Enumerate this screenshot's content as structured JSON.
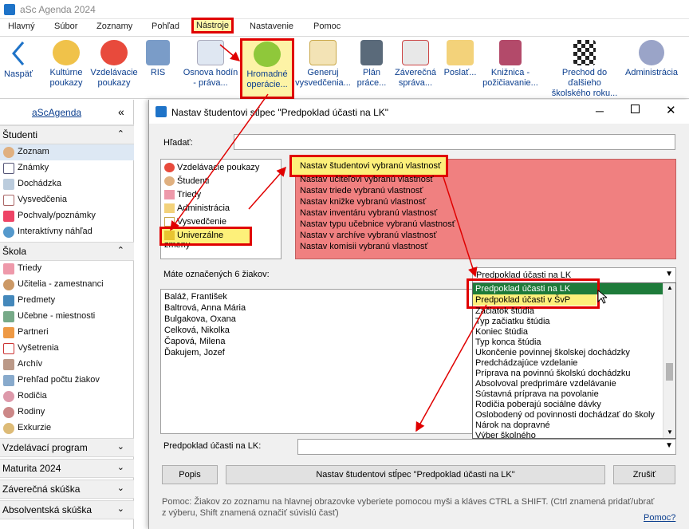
{
  "window": {
    "title": "aSc Agenda 2024"
  },
  "menubar": [
    "Hlavný",
    "Súbor",
    "Zoznamy",
    "Pohľad",
    "Nástroje",
    "Nastavenie",
    "Pomoc"
  ],
  "ribbon": [
    {
      "label": "Naspäť"
    },
    {
      "label": "Kultúrne poukazy"
    },
    {
      "label": "Vzdelávacie poukazy"
    },
    {
      "label": "RIS"
    },
    {
      "label": "Osnova hodín - práva..."
    },
    {
      "label": "Hromadné operácie..."
    },
    {
      "label": "Generuj vysvedčenia..."
    },
    {
      "label": "Plán práce..."
    },
    {
      "label": "Záverečná správa..."
    },
    {
      "label": "Poslať..."
    },
    {
      "label": "Knižnica - požičiavanie..."
    },
    {
      "label": "Prechod do ďalšieho školského roku..."
    },
    {
      "label": "Administrácia"
    }
  ],
  "sidebar": {
    "brand": "aScAgenda",
    "sec_studenti": "Študenti",
    "studenti_items": [
      "Zoznam",
      "Známky",
      "Dochádzka",
      "Vysvedčenia",
      "Pochvaly/poznámky",
      "Interaktívny náhľad"
    ],
    "sec_skola": "Škola",
    "skola_items": [
      "Triedy",
      "Učitelia - zamestnanci",
      "Predmety",
      "Učebne - miestnosti",
      "Partneri",
      "Vyšetrenia",
      "Archív",
      "Prehľad počtu žiakov",
      "Rodičia",
      "Rodiny",
      "Exkurzie"
    ],
    "collapsed": [
      "Vzdelávací program",
      "Maturita 2024",
      "Záverečná skúška",
      "Absolventská skúška"
    ]
  },
  "dialog": {
    "title": "Nastav študentovi stĺpec \"Predpoklad účasti na LK\"",
    "search_label": "Hľadať:",
    "categories": [
      "Vzdelávacie poukazy",
      "Študenti",
      "Triedy",
      "Administrácia",
      "Vysvedčenie",
      "Univerzálne zmeny"
    ],
    "actions": [
      "Nastav študentovi vybranú vlastnosť",
      "Nastav učiteľovi vybranú vlastnosť",
      "Nastav triede vybranú vlastnosť",
      "Nastav knižke vybranú vlastnosť",
      "Nastav inventáru vybranú vlastnosť",
      "Nastav typu učebnice vybranú vlastnosť",
      "Nastav v archíve vybranú vlastnosť",
      "Nastav komisii vybranú vlastnosť"
    ],
    "marked_label": "Máte označených 6 žiakov:",
    "students": [
      "Baláž, František",
      "Baltrová, Anna Mária",
      "Bulgakova, Oxana",
      "Celková, Nikolka",
      "Čapová, Milena",
      "Ďakujem, Jozef"
    ],
    "combo_value": "Predpoklad účasti na LK",
    "dropdown": [
      "Predpoklad účasti na LK",
      "Predpoklad účasti v ŠvP",
      "Začiatok štúdia",
      "Typ začiatku štúdia",
      "Koniec štúdia",
      "Typ konca štúdia",
      "Ukončenie povinnej školskej dochádzky",
      "Predchádzajúce vzdelanie",
      "Príprava na povinnú školskú dochádzku",
      "Absolvoval predprimáre vzdelávanie",
      "Sústavná príprava na povolanie",
      "Rodičia poberajú sociálne dávky",
      "Oslobodený od povinnosti dochádzať do školy",
      "Nárok na dopravné",
      "Výber školného"
    ],
    "field_label": "Predpoklad účasti na LK:",
    "btn_popis": "Popis",
    "btn_set": "Nastav študentovi stĺpec \"Predpoklad účasti na LK\"",
    "btn_close": "Zrušiť",
    "help_1": "Pomoc: Žiakov zo zoznamu na hlavnej obrazovke vyberiete pomocou myši a kláves CTRL a SHIFT. (Ctrl znamená pridať/ubrať",
    "help_2": "z výberu, Shift znamená označiť súvislú časť)",
    "help_link": "Pomoc?"
  },
  "colors": {
    "highlight": "#e00000",
    "actions_bg": "#f08080",
    "accent": "#0b3e8e",
    "dropdown_sel": "#1e7b3a"
  }
}
